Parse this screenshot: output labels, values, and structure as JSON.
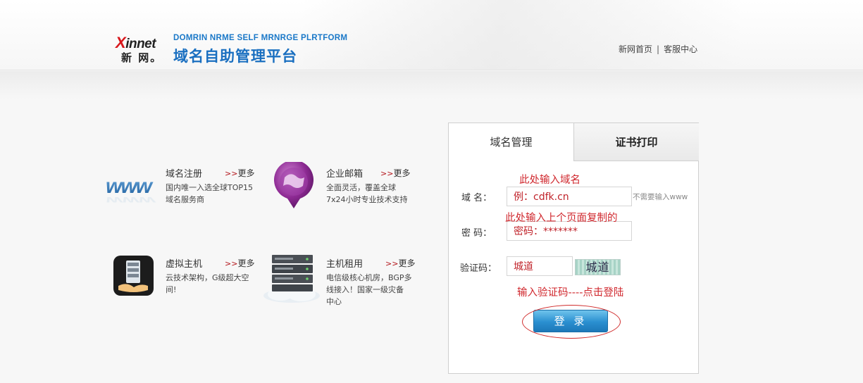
{
  "header": {
    "logo_en": "innet",
    "logo_x": "X",
    "logo_cn": "新 网。",
    "subtitle_en": "DOMRIN NRME SELF MRNRGE PLRTFORM",
    "subtitle_cn": "域名自助管理平台",
    "links": [
      "新网首页",
      "客服中心"
    ],
    "link_separator": "|"
  },
  "services": [
    {
      "icon": "www-icon",
      "title": "域名注册",
      "more": "更多",
      "desc": [
        "国内唯一入选全球TOP15",
        "域名服务商"
      ]
    },
    {
      "icon": "mail-globe-icon",
      "title": "企业邮箱",
      "more": "更多",
      "desc": [
        "全面灵活，覆盖全球",
        "7x24小时专业技术支持"
      ]
    },
    {
      "icon": "virtual-host-icon",
      "title": "虚拟主机",
      "more": "更多",
      "desc": [
        "云技术架构，G级超大空",
        "间!"
      ]
    },
    {
      "icon": "server-rack-icon",
      "title": "主机租用",
      "more": "更多",
      "desc": [
        "电信级核心机房，BGP多",
        "线接入！国家一级灾备",
        "中心"
      ]
    }
  ],
  "more_arrow": ">>",
  "login": {
    "tabs": [
      "域名管理",
      "证书打印"
    ],
    "domain_label": "域  名：",
    "domain_value": "例：cdfk.cn",
    "domain_hint": "不需要输入www",
    "password_label": "密  码：",
    "password_value": "密码：*******",
    "captcha_label": "验证码：",
    "captcha_value": "城道",
    "captcha_image_text": "城道",
    "login_button": "登 录"
  },
  "annotations": {
    "domain": "此处输入域名",
    "password": "此处输入上个页面复制的",
    "captcha": "输入验证码----点击登陆"
  },
  "colors": {
    "brand_blue": "#1a6fc0",
    "brand_red": "#d8161b",
    "annotation_red": "#d0282e"
  }
}
